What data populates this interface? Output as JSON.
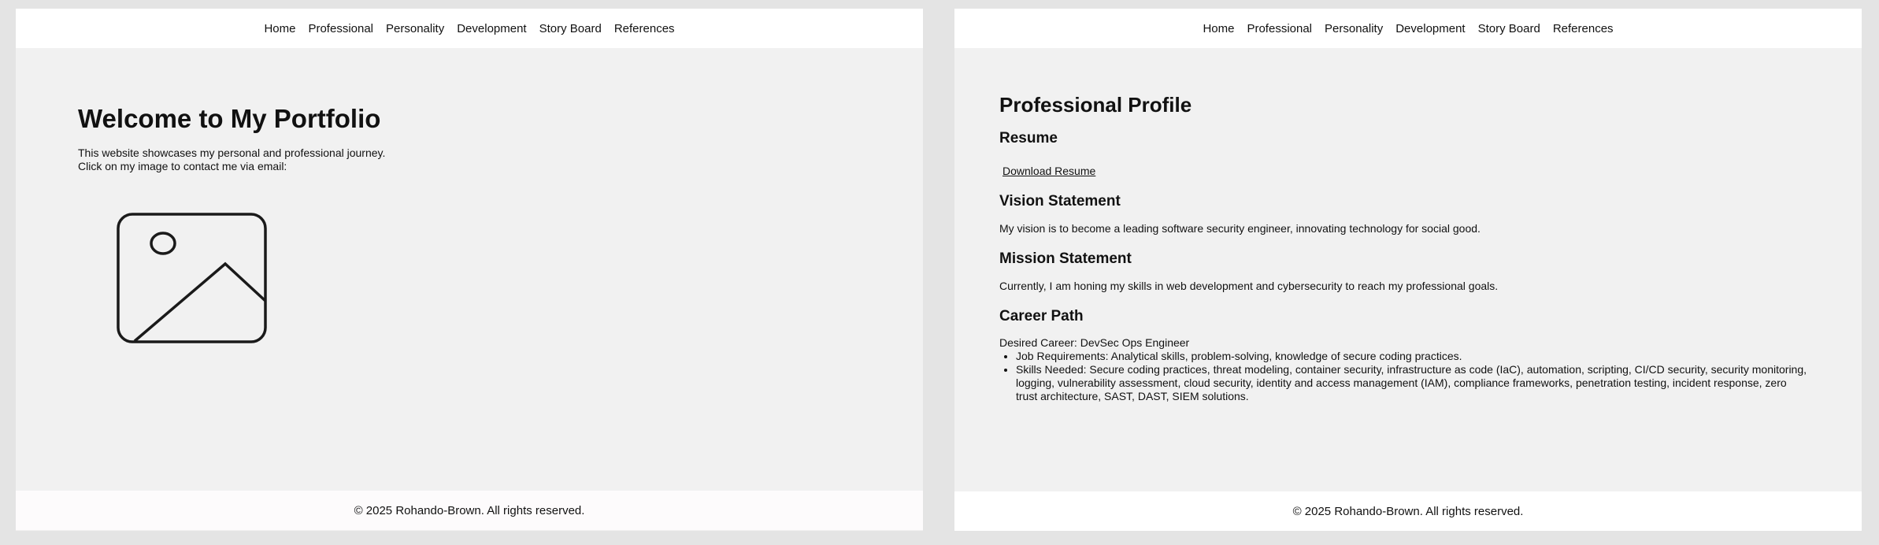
{
  "nav": {
    "items": [
      "Home",
      "Professional",
      "Personality",
      "Development",
      "Story Board",
      "References"
    ]
  },
  "home": {
    "title": "Welcome to My Portfolio",
    "line1": "This website showcases my personal and professional journey.",
    "line2": "Click on my image to contact me via email:",
    "image_icon": "image-placeholder-icon"
  },
  "professional": {
    "title": "Professional Profile",
    "resume_heading": "Resume",
    "resume_link": "Download Resume",
    "vision_heading": "Vision Statement",
    "vision_text": "My vision is to become a leading software security engineer, innovating technology for social good.",
    "mission_heading": "Mission Statement",
    "mission_text": "Currently, I am honing my skills in web development and cybersecurity to reach my professional goals.",
    "career_heading": "Career Path",
    "desired_career": "Desired Career: DevSec Ops Engineer",
    "bullets": [
      "Job Requirements: Analytical skills, problem-solving, knowledge of secure coding practices.",
      "Skills Needed: Secure coding practices, threat modeling, container security, infrastructure as code (IaC), automation,  scripting, CI/CD security, security monitoring, logging, vulnerability  assessment, cloud security, identity and access management (IAM),  compliance frameworks, penetration testing, incident response, zero  trust architecture, SAST, DAST, SIEM solutions."
    ]
  },
  "footer": {
    "text": "© 2025 Rohando-Brown. All rights reserved."
  }
}
